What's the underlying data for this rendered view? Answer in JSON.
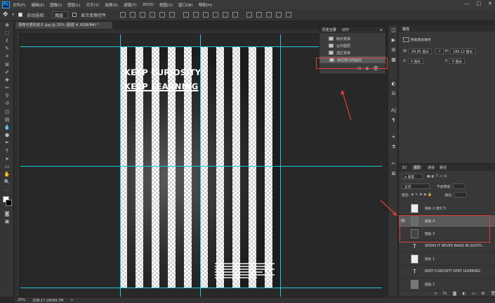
{
  "app": {
    "logo": "Ps"
  },
  "menu": [
    "文件(F)",
    "编辑(E)",
    "图像(I)",
    "图层(L)",
    "文字(Y)",
    "选择(S)",
    "滤镜(T)",
    "3D(D)",
    "视图(V)",
    "窗口(W)",
    "帮助(H)"
  ],
  "window_controls": {
    "minimize": "—",
    "maximize": "□",
    "close": "✕"
  },
  "options": {
    "auto_select_label": "自动选择：",
    "auto_select_value": "图层",
    "show_transform_label": "显示变换控件"
  },
  "document": {
    "tab_label": "漂亮可爱的孩子.jpg @ 25% (图层 4, RGB/8#) *",
    "title_line1": "KEEP CURIOSITY",
    "title_line2": "KEEP LEARNING"
  },
  "history": {
    "tabs": [
      "历史记录",
      "动作"
    ],
    "items": [
      "两次变换",
      "合并图层",
      "选区变换",
      "通过拷贝的图层"
    ],
    "selected_index": 3
  },
  "properties": {
    "header": "属性",
    "subtitle": "像素图层属性",
    "w_label": "W:",
    "w_value": "69.85 厘米",
    "h_label": "H:",
    "h_value": "186.12 厘米",
    "x_label": "X:",
    "x_value": "0 厘米",
    "y_label": "Y:",
    "y_value": "0 厘米"
  },
  "layers": {
    "tabs": [
      "3D",
      "图层",
      "通道",
      "路径"
    ],
    "filter_label": "ρ 类型",
    "blend_mode": "正常",
    "opacity_label": "不透明度:",
    "lock_label": "锁定:",
    "fill_label": "填充:",
    "items": [
      {
        "name": "矩形 2 拷贝 5",
        "kind": "shape",
        "visible": false,
        "active": false
      },
      {
        "name": "图层 4",
        "kind": "pixel",
        "visible": true,
        "active": true
      },
      {
        "name": "图层 3",
        "kind": "pixel",
        "visible": false,
        "active": false
      },
      {
        "name": "SEEMS IT NEVER RAINS IN SOUTH...",
        "kind": "text",
        "visible": false,
        "active": false
      },
      {
        "name": "矩形 1",
        "kind": "shape",
        "visible": false,
        "active": false
      },
      {
        "name": "KEEP CURIOSITY KEEP LEARNING",
        "kind": "text",
        "visible": false,
        "active": false
      },
      {
        "name": "图层 2",
        "kind": "pixel",
        "visible": false,
        "active": false
      }
    ]
  },
  "status": {
    "zoom": "25%",
    "doc_size": "文档:17.2M/89.7M"
  },
  "colors": {
    "annotation_red": "#e03b3b",
    "guide_cyan": "#22c8e0",
    "ps_blue": "#31a8ff"
  }
}
